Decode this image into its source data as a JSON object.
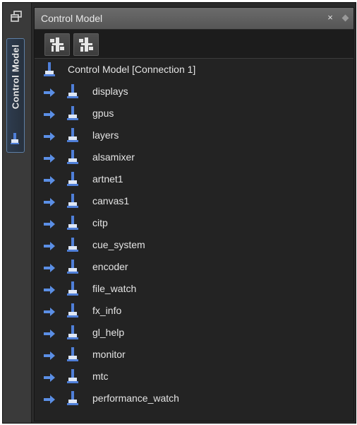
{
  "side": {
    "tab_label": "Control Model"
  },
  "panel": {
    "title": "Control Model",
    "close_glyph": "×"
  },
  "icons": {
    "restore": "restore-window-icon",
    "collapse_all": "collapse-tree-icon",
    "expand_all": "expand-tree-icon",
    "node": "connector-node-icon",
    "expander": "expand-arrow-icon"
  },
  "colors": {
    "accent": "#5d7fa6",
    "node_blue": "#4f7fd8",
    "background": "#232323"
  },
  "tree": {
    "root_label": "Control Model [Connection 1]",
    "items": [
      {
        "label": "displays"
      },
      {
        "label": "gpus"
      },
      {
        "label": "layers"
      },
      {
        "label": "alsamixer"
      },
      {
        "label": "artnet1"
      },
      {
        "label": "canvas1"
      },
      {
        "label": "citp"
      },
      {
        "label": "cue_system"
      },
      {
        "label": "encoder"
      },
      {
        "label": "file_watch"
      },
      {
        "label": "fx_info"
      },
      {
        "label": "gl_help"
      },
      {
        "label": "monitor"
      },
      {
        "label": "mtc"
      },
      {
        "label": "performance_watch"
      }
    ]
  }
}
